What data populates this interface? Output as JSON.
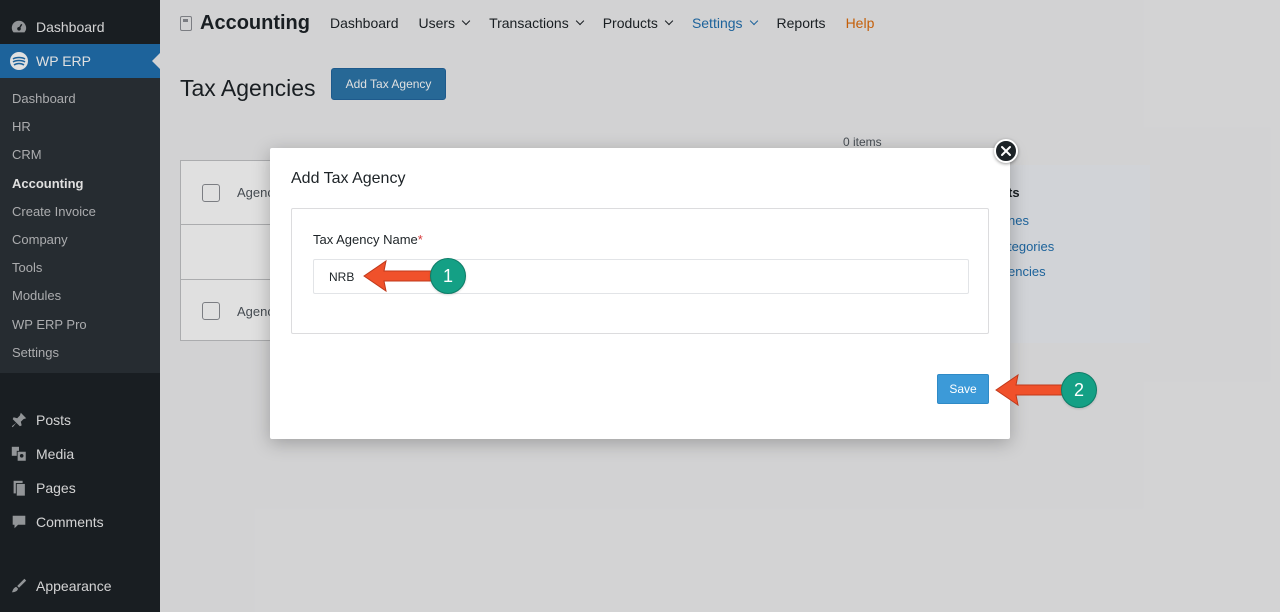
{
  "sidebar": {
    "dashboard": "Dashboard",
    "wperp": "WP ERP",
    "submenu": [
      {
        "label": "Dashboard",
        "active": false
      },
      {
        "label": "HR",
        "active": false
      },
      {
        "label": "CRM",
        "active": false
      },
      {
        "label": "Accounting",
        "active": true
      },
      {
        "label": "Create Invoice",
        "active": false
      },
      {
        "label": "Company",
        "active": false
      },
      {
        "label": "Tools",
        "active": false
      },
      {
        "label": "Modules",
        "active": false
      },
      {
        "label": "WP ERP Pro",
        "active": false
      },
      {
        "label": "Settings",
        "active": false
      }
    ],
    "posts": "Posts",
    "media": "Media",
    "pages": "Pages",
    "comments": "Comments",
    "appearance": "Appearance"
  },
  "nav": {
    "brand": "Accounting",
    "items": {
      "dashboard": "Dashboard",
      "users": "Users",
      "transactions": "Transactions",
      "products": "Products",
      "settings": "Settings",
      "reports": "Reports",
      "help": "Help"
    }
  },
  "page": {
    "title": "Tax Agencies",
    "add_button": "Add Tax Agency",
    "items_count": "0 items",
    "table_col": "Agenc",
    "shortcuts_heading_partial": "ts",
    "shortcut_links": [
      "nes",
      "tegories",
      "encies"
    ]
  },
  "modal": {
    "title": "Add Tax Agency",
    "field_label": "Tax Agency Name",
    "required_mark": "*",
    "field_value": "NRB",
    "save_label": "Save"
  },
  "annotations": {
    "step1": "1",
    "step2": "2",
    "arrow_color": "#f0512b",
    "badge_color": "#14a085"
  }
}
